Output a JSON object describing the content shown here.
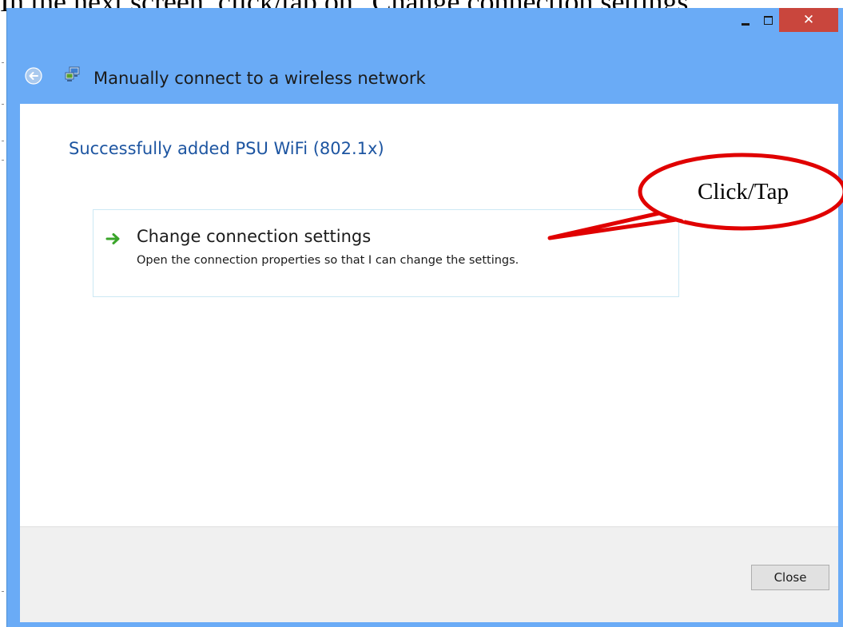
{
  "document": {
    "heading": "In the next screen, click/tap on \"Change connection settings\"."
  },
  "window": {
    "title": "Manually connect to a wireless network",
    "controls": {
      "minimize_icon": "minimize-icon",
      "maximize_icon": "maximize-icon",
      "close_glyph": "✕"
    },
    "back_icon": "back-arrow-icon",
    "title_icon": "network-connection-icon",
    "accent_color": "#6aabf6",
    "close_color": "#c9463d"
  },
  "content": {
    "success_message": "Successfully added PSU WiFi (802.1x)",
    "option": {
      "icon": "green-arrow-icon",
      "title": "Change connection settings",
      "description": "Open the connection properties so that I can change the settings."
    }
  },
  "footer": {
    "close_label": "Close"
  },
  "annotation": {
    "callout_text": "Click/Tap",
    "color": "#e00000"
  }
}
